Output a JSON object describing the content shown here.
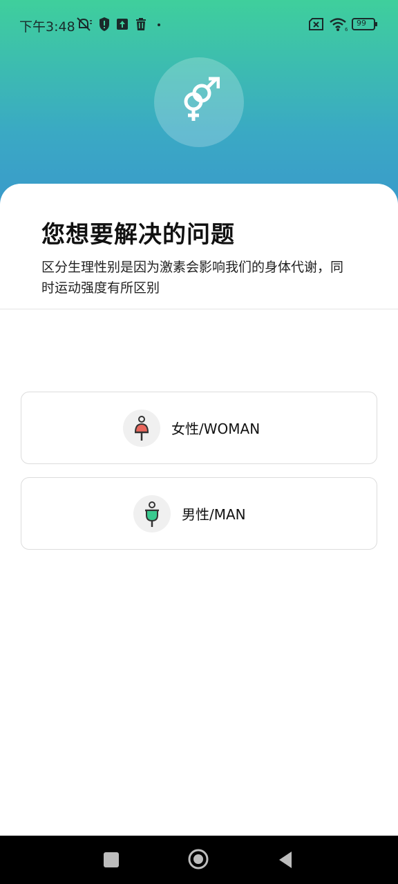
{
  "status_bar": {
    "time": "下午3:48",
    "battery": "99",
    "icons": [
      "mute-icon",
      "shield-icon",
      "upload-icon",
      "trash-icon",
      "dot-icon",
      "sim-icon",
      "wifi-icon",
      "battery-icon"
    ]
  },
  "hero": {
    "icon": "gender-icon"
  },
  "main": {
    "title": "您想要解决的问题",
    "description": "区分生理性别是因为激素会影响我们的身体代谢，同时运动强度有所区别",
    "options": [
      {
        "label": "女性/WOMAN",
        "icon": "female-icon",
        "accent": "#e8675d"
      },
      {
        "label": "男性/MAN",
        "icon": "male-icon",
        "accent": "#39c98f"
      }
    ]
  },
  "nav_bar": {
    "buttons": [
      "recents-button",
      "home-button",
      "back-button"
    ]
  },
  "colors": {
    "gradient_top": "#3fcf9c",
    "gradient_bottom": "#3a97cc"
  }
}
